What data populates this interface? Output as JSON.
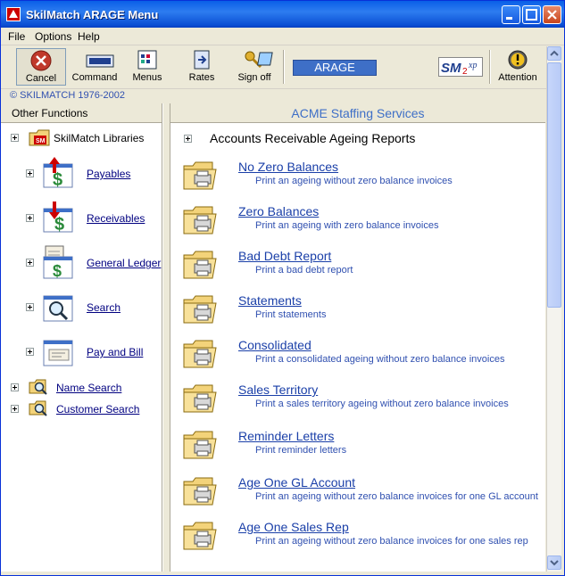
{
  "window": {
    "title": "SkilMatch ARAGE Menu"
  },
  "menu": {
    "file": "File",
    "options": "Options",
    "help": "Help"
  },
  "toolbar": {
    "cancel": "Cancel",
    "command": "Command",
    "menus": "Menus",
    "rates": "Rates",
    "signoff": "Sign off",
    "arage": "ARAGE",
    "logo": "SM2xp",
    "attention": "Attention"
  },
  "copyright": "© SKILMATCH 1976-2002",
  "left": {
    "header": "Other Functions",
    "root": "SkilMatch Libraries",
    "items": [
      {
        "label": "Payables",
        "icon": "payables-icon"
      },
      {
        "label": "Receivables",
        "icon": "receivables-icon"
      },
      {
        "label": "General Ledger",
        "icon": "ledger-icon"
      },
      {
        "label": "Search",
        "icon": "search-icon"
      },
      {
        "label": "Pay and Bill",
        "icon": "pay-bill-icon"
      }
    ],
    "bottom": [
      {
        "label": "Name Search"
      },
      {
        "label": "Customer Search"
      }
    ]
  },
  "right": {
    "header": "ACME Staffing Services",
    "section": "Accounts Receivable Ageing Reports",
    "reports": [
      {
        "title": "No Zero Balances",
        "desc": "Print an ageing without zero balance invoices"
      },
      {
        "title": "Zero Balances",
        "desc": "Print an ageing with zero balance invoices"
      },
      {
        "title": "Bad Debt Report",
        "desc": "Print a bad debt report"
      },
      {
        "title": "Statements",
        "desc": "Print statements"
      },
      {
        "title": "Consolidated",
        "desc": "Print a consolidated ageing without zero balance invoices"
      },
      {
        "title": "Sales Territory",
        "desc": "Print a sales territory ageing without zero balance invoices"
      },
      {
        "title": "Reminder Letters",
        "desc": "Print reminder letters"
      },
      {
        "title": "Age One GL Account",
        "desc": "Print an ageing without zero balance invoices for one GL account"
      },
      {
        "title": "Age One Sales Rep",
        "desc": "Print an ageing without zero balance invoices for one sales rep"
      }
    ]
  },
  "colors": {
    "titlebar": "#0a5fe8",
    "link": "#1a3fa8",
    "accent": "#3e6fc7"
  }
}
